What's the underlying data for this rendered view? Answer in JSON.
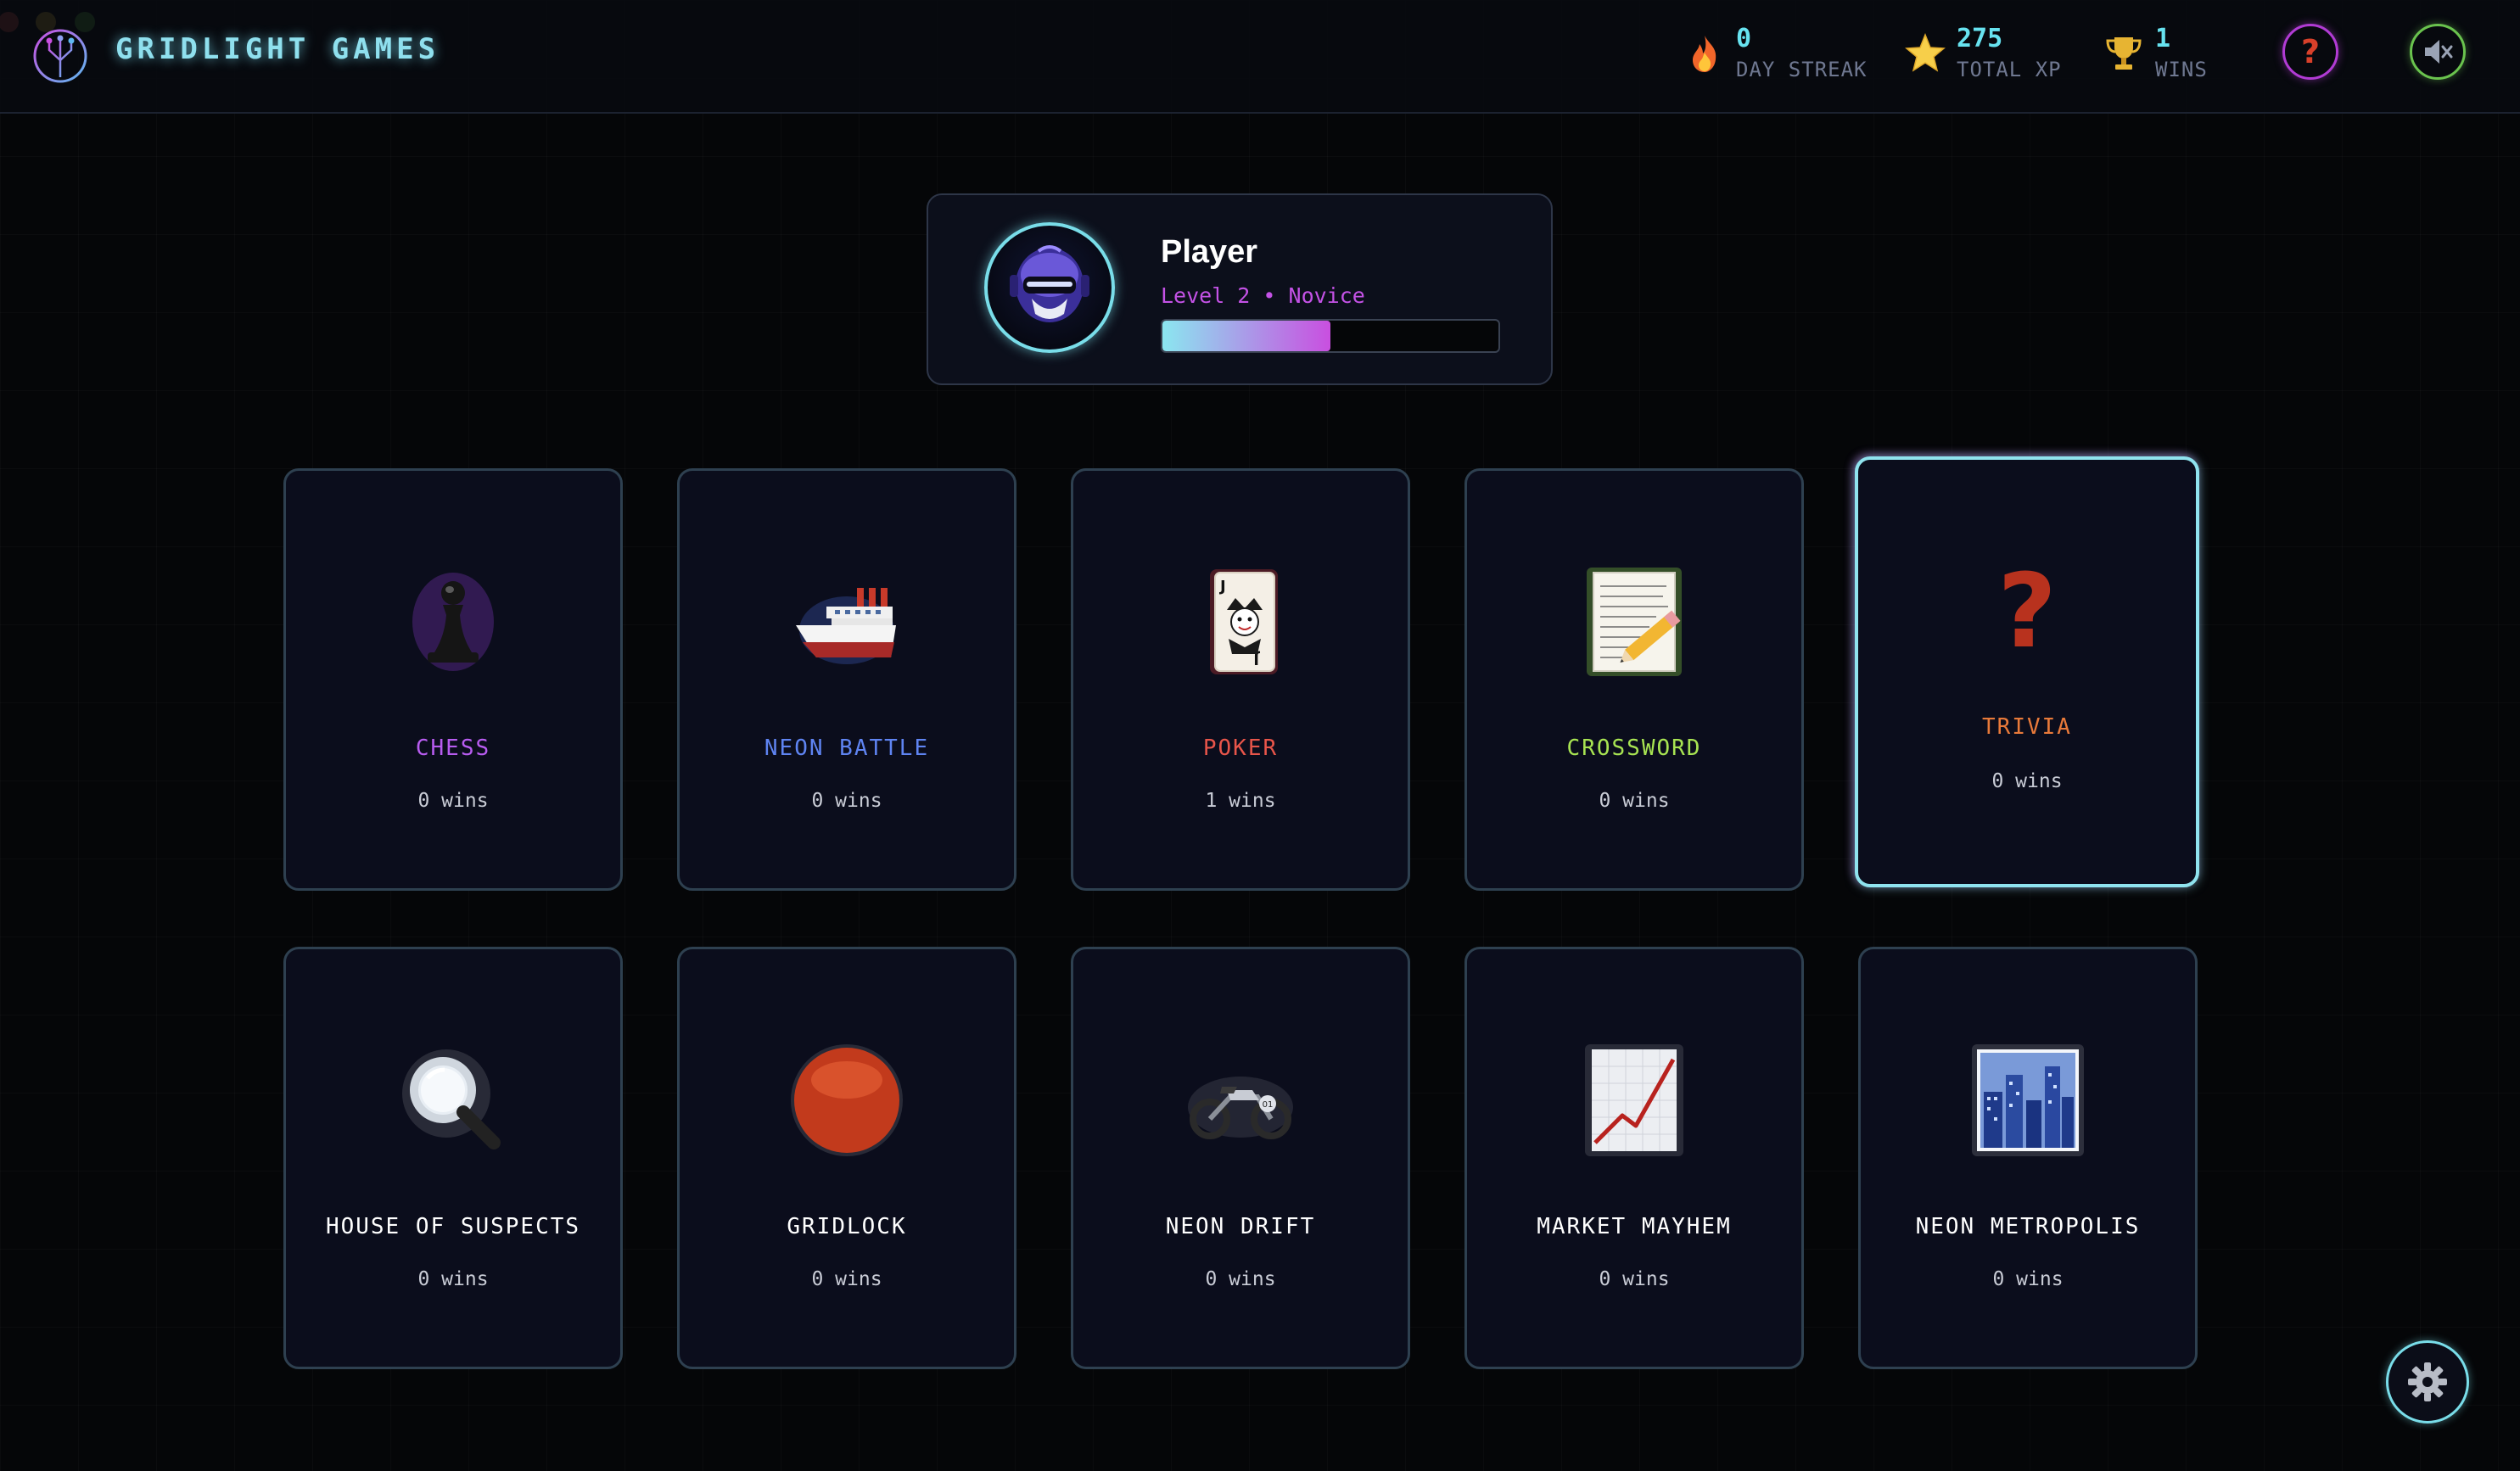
{
  "brand": {
    "name": "GRIDLIGHT GAMES"
  },
  "stats": [
    {
      "icon": "fire-icon",
      "value": "0",
      "label": "DAY STREAK"
    },
    {
      "icon": "star-icon",
      "value": "275",
      "label": "TOTAL XP"
    },
    {
      "icon": "trophy-icon",
      "value": "1",
      "label": "WINS"
    }
  ],
  "header_buttons": {
    "help_icon": "question-mark-icon",
    "sound_icon": "speaker-muted-icon"
  },
  "profile": {
    "name": "Player",
    "level_text": "Level 2 • Novice",
    "xp_progress": 0.5,
    "avatar_icon": "robot-helmet-avatar"
  },
  "games": [
    {
      "title": "CHESS",
      "wins": "0 wins",
      "icon": "chess-pawn-icon",
      "color": "#b85cf0",
      "active": false
    },
    {
      "title": "NEON BATTLE",
      "wins": "0 wins",
      "icon": "ship-icon",
      "color": "#5f84f2",
      "active": false
    },
    {
      "title": "POKER",
      "wins": "1 wins",
      "icon": "joker-card-icon",
      "color": "#e8554a",
      "active": false
    },
    {
      "title": "CROSSWORD",
      "wins": "0 wins",
      "icon": "memo-pencil-icon",
      "color": "#a8e452",
      "active": false
    },
    {
      "title": "TRIVIA",
      "wins": "0 wins",
      "icon": "question-mark-icon",
      "color": "#e97a3a",
      "active": true
    },
    {
      "title": "HOUSE OF SUSPECTS",
      "wins": "0 wins",
      "icon": "magnifying-glass-icon",
      "color": "#ffffff",
      "active": false
    },
    {
      "title": "GRIDLOCK",
      "wins": "0 wins",
      "icon": "red-circle-icon",
      "color": "#ffffff",
      "active": false
    },
    {
      "title": "NEON DRIFT",
      "wins": "0 wins",
      "icon": "motorcycle-icon",
      "color": "#ffffff",
      "active": false
    },
    {
      "title": "MARKET MAYHEM",
      "wins": "0 wins",
      "icon": "chart-increasing-icon",
      "color": "#ffffff",
      "active": false
    },
    {
      "title": "NEON METROPOLIS",
      "wins": "0 wins",
      "icon": "cityscape-icon",
      "color": "#ffffff",
      "active": false
    }
  ],
  "settings": {
    "icon": "gear-icon"
  }
}
